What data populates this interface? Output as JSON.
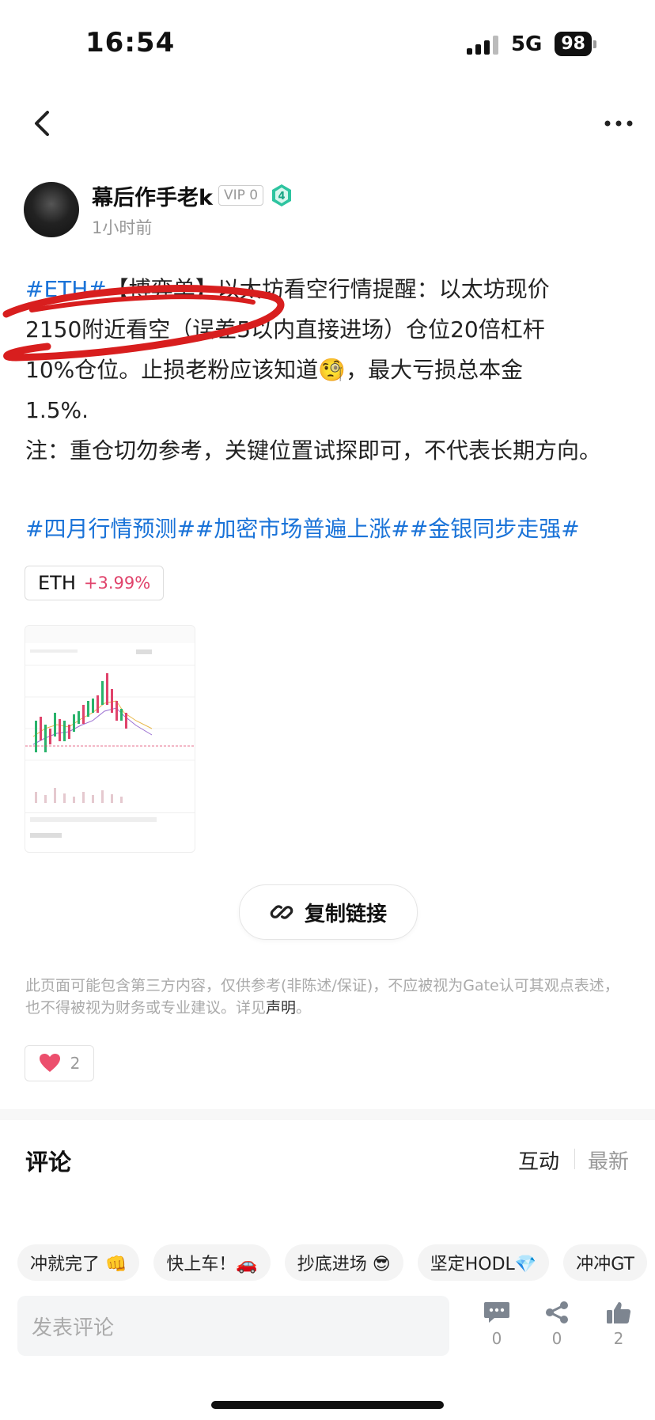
{
  "status_bar": {
    "time": "16:54",
    "network": "5G",
    "battery": "98"
  },
  "author": {
    "name": "幕后作手老k",
    "vip": "VIP 0",
    "level": "4",
    "time": "1小时前"
  },
  "post": {
    "tag_eth": "#ETH#",
    "line1_rest": "【博弈单】以太坊看空行情提醒：以太坊现价",
    "line2": "2150附近看空（误差5以内直接进场）仓位20倍杠杆",
    "line3": "10%仓位。止损老粉应该知道🧐，最大亏损总本金",
    "line4": "1.5%.",
    "note": "注：重仓切勿参考，关键位置试探即可，不代表长期方向。",
    "hashtags": "#四月行情预测##加密市场普遍上涨##金银同步走强#"
  },
  "coin": {
    "symbol": "ETH",
    "change": "+3.99%"
  },
  "copy_link": {
    "label": "复制链接"
  },
  "disclaimer": {
    "text": "此页面可能包含第三方内容，仅供参考(非陈述/保证)，不应被视为Gate认可其观点表述，也不得被视为财务或专业建议。详见",
    "link": "声明",
    "end": "。"
  },
  "likes": {
    "count": "2"
  },
  "comments": {
    "title": "评论",
    "sort_interact": "互动",
    "sort_latest": "最新",
    "quick_replies": [
      "冲就完了 👊",
      "快上车！🚗",
      "抄底进场 😎",
      "坚定HODL💎",
      "冲冲GT"
    ],
    "input_placeholder": "发表评论",
    "actions": {
      "comment_count": "0",
      "share_count": "0",
      "like_count": "2"
    }
  },
  "colors": {
    "link_blue": "#1a73d8",
    "positive_red": "#e0436b",
    "scribble_red": "#d81e1e"
  }
}
